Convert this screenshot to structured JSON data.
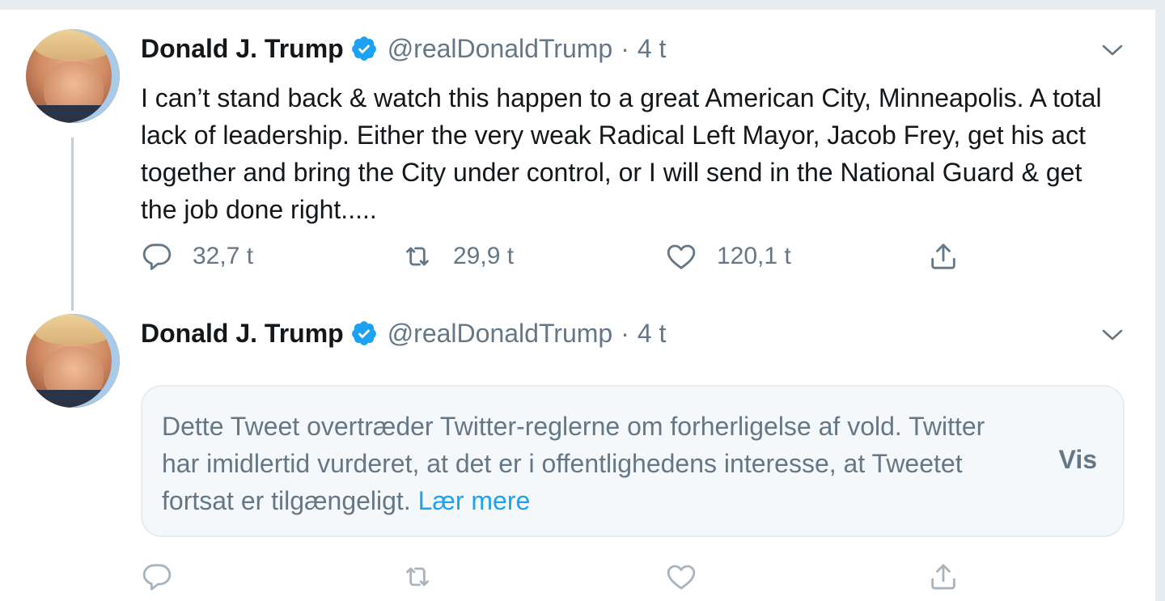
{
  "colors": {
    "text": "#14171a",
    "secondary": "#657786",
    "accent": "#1da1f2",
    "background": "#e6ecf0",
    "notice_background": "#f5f8fa"
  },
  "tweets": [
    {
      "author_name": "Donald J. Trump",
      "verified_icon": "verified-badge-icon",
      "handle": "@realDonaldTrump",
      "separator": "·",
      "time": "4 t",
      "text": "I can’t stand back & watch this happen to a great American City, Minneapolis. A total lack of leadership. Either the very weak Radical Left Mayor, Jacob Frey, get his act together and bring the City under control, or I will send in the National Guard & get the job done right.....",
      "actions": {
        "reply": {
          "icon": "reply-icon",
          "count": "32,7 t"
        },
        "retweet": {
          "icon": "retweet-icon",
          "count": "29,9 t"
        },
        "like": {
          "icon": "heart-icon",
          "count": "120,1 t"
        },
        "share": {
          "icon": "share-icon"
        }
      }
    },
    {
      "author_name": "Donald J. Trump",
      "verified_icon": "verified-badge-icon",
      "handle": "@realDonaldTrump",
      "separator": "·",
      "time": "4 t",
      "notice": {
        "text": "Dette Tweet overtræder Twitter-reglerne om forherligelse af vold. Twitter har imidlertid vurderet, at det er i offentlighedens interesse, at Tweetet fortsat er tilgængeligt.",
        "learn_more": "Lær mere",
        "show_label": "Vis"
      },
      "actions": {
        "reply": {
          "icon": "reply-icon"
        },
        "retweet": {
          "icon": "retweet-icon"
        },
        "like": {
          "icon": "heart-icon"
        },
        "share": {
          "icon": "share-icon"
        }
      }
    }
  ]
}
